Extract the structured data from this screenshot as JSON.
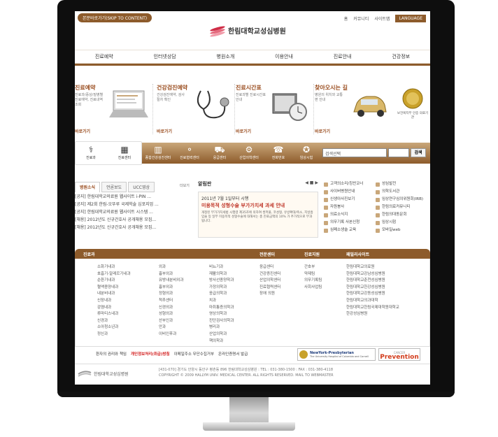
{
  "skip": "본문바로가기(SKIP TO CONTENT)",
  "util": [
    "홈",
    "커뮤니티",
    "사이트맵",
    "LANGUAGE"
  ],
  "logo": "한림대학교성심병원",
  "gnb": [
    "진료예약",
    "인터넷상담",
    "병원소개",
    "이용안내",
    "진료안내",
    "건강정보"
  ],
  "quick": [
    {
      "title": "진료예약",
      "desc": "진료과/증상/질병별 진료예약, 진료내역조회",
      "go": "바로가기"
    },
    {
      "title": "건강검진예약",
      "desc": "건강검진예약, 검사절차 확인",
      "go": "바로가기"
    },
    {
      "title": "진료시간표",
      "desc": "진료과별 진료시간표 안내",
      "go": "바로가기"
    },
    {
      "title": "찾아오시는 길",
      "desc": "병원의 위치와 교통편 안내",
      "go": "바로가기"
    }
  ],
  "award": "보건복지부 인증 의료기관",
  "bar": {
    "items": [
      "진료과",
      "진료센터",
      "종합건강검진센터",
      "진료협력센터",
      "응급센터",
      "산업의학센터",
      "전화번호",
      "임상시험"
    ],
    "search_placeholder": "검색선택",
    "search_btn": "검색"
  },
  "tabs": [
    "병원소식",
    "언론보도",
    "UCC영상"
  ],
  "more": "더보기",
  "news": [
    "[공지] 한림대학교의료원 웹사이트 i-PIN ...",
    "[공지] 제2회 한림-오뚜루 국제학술 심포지엄 ...",
    "[공지] 한림대학교의료원 웹사이트 시스템 ...",
    "[채용] 2012년도 신규간호사 공개채용 모집...",
    "[채용] 2012년도 신규간호사 공개채용 모집..."
  ],
  "alim": {
    "head": "알림판",
    "pager": "◀ ■ ▶",
    "date": "2011년 7월 1일부터 시행",
    "title": "미용목적 성형수술 부가가치세 과세 안내",
    "body": "개정된 부가가치세법 시행령 제35조에 의하여 쌍꺼풀, 코성형, 유방확대/축소, 지방흡입술 등 일부 미용목적 성형수술에 대해서는 총 진료금액의 10% 가 추가적으로 부과됩니다."
  },
  "links1": [
    "고객의소리/칭찬코너",
    "사이버병원안내",
    "신생아사진보기",
    "자원봉사",
    "의료소식지",
    "의무기록 사본신청",
    "심폐소생술 교육"
  ],
  "links2": [
    "성심발전",
    "의학도서관",
    "임상연구심의위원회(IRB)",
    "한림의료커뮤니티",
    "한림의대동문회",
    "임상시험",
    "모바일web"
  ],
  "sitemap": {
    "heads": [
      "진료과",
      "전문센터",
      "진료지원",
      "패밀리사이트"
    ],
    "c1": [
      "소화기내과",
      "호흡기-알레르기내과",
      "순환기내과",
      "혈액종양내과",
      "내분비내과",
      "신장내과",
      "감염내과",
      "류마티스내과",
      "신경과",
      "소아청소년과",
      "정신과"
    ],
    "c2": [
      "외과",
      "흉부외과",
      "유방내분비외과",
      "흉부외과",
      "정형외과",
      "척추센터",
      "신경외과",
      "성형외과",
      "산부인과",
      "안과",
      "이비인후과"
    ],
    "c3": [
      "비뇨기과",
      "재활의학과",
      "방사선종양학과",
      "가정의학과",
      "응급의학과",
      "치과",
      "마취통증의학과",
      "영상의학과",
      "진단검사의학과",
      "병리과",
      "산업의학과",
      "핵의학과"
    ],
    "c4": [
      "응급센터",
      "건강증진센터",
      "산업의학센터",
      "진료협력센터",
      "장애 의원"
    ],
    "c5": [
      "간호부",
      "약제팀",
      "의무기록팀",
      "사회사업팀"
    ],
    "c6": [
      "한림대학교의료원",
      "한림대학교강남성심병원",
      "한림대학교춘천성심병원",
      "한림대학교한강성심병원",
      "한림대학교강동성심병원",
      "한림대학교의과대학",
      "한림대학교한림국제대학원대학교",
      "한강성심병원"
    ]
  },
  "footlinks": [
    "환자의 권리와 책임",
    "개인정보처리(취급)방침",
    "이메일주소 무단수집거부",
    "온라인증명서 발급"
  ],
  "partner1": "NewYork-Presbyterian",
  "partner1sub": "The University Hospital of Columbia and Cornell",
  "partner2": "Prevention",
  "partner2top": "CANCER",
  "flogo": "한림대학교성심병원",
  "addr1": "[431-070] 경기도 안양시 동안구 평촌동 896 한림대학교성심병원 : TEL : 031-380-1500 : FAX : 031-380-4118",
  "addr2": "COPYRIGHT © 2009 HALLYM UNIV. MEDICAL CENTER. ALL RIGHTS RESERVED. MAIL TO WEBMASTER"
}
